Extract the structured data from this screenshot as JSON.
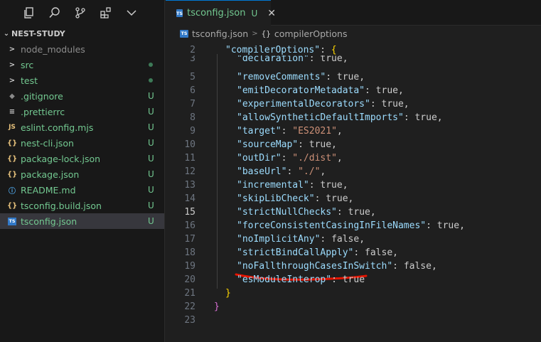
{
  "sidebar": {
    "project_name": "NEST-STUDY",
    "items": [
      {
        "name": "node_modules",
        "kind": "folder",
        "icon": ">",
        "color": "#8c8c8c",
        "badge": "",
        "dot": false
      },
      {
        "name": "src",
        "kind": "folder",
        "icon": ">",
        "color": "#73c991",
        "badge": "",
        "dot": true
      },
      {
        "name": "test",
        "kind": "folder",
        "icon": ">",
        "color": "#73c991",
        "badge": "",
        "dot": true
      },
      {
        "name": ".gitignore",
        "kind": "file",
        "icon": "◆",
        "iconColor": "#8a8a8a",
        "color": "#73c991",
        "badge": "U",
        "dot": false
      },
      {
        "name": ".prettierrc",
        "kind": "file",
        "icon": "≡",
        "iconColor": "#cccccc",
        "color": "#73c991",
        "badge": "U",
        "dot": false
      },
      {
        "name": "eslint.config.mjs",
        "kind": "file",
        "icon": "JS",
        "iconColor": "#e5c07b",
        "color": "#73c991",
        "badge": "U",
        "dot": false
      },
      {
        "name": "nest-cli.json",
        "kind": "file",
        "icon": "{}",
        "iconColor": "#e5c07b",
        "color": "#73c991",
        "badge": "U",
        "dot": false
      },
      {
        "name": "package-lock.json",
        "kind": "file",
        "icon": "{}",
        "iconColor": "#e5c07b",
        "color": "#73c991",
        "badge": "U",
        "dot": false
      },
      {
        "name": "package.json",
        "kind": "file",
        "icon": "{}",
        "iconColor": "#e5c07b",
        "color": "#73c991",
        "badge": "U",
        "dot": false
      },
      {
        "name": "README.md",
        "kind": "file",
        "icon": "ⓘ",
        "iconColor": "#4fa6e8",
        "color": "#73c991",
        "badge": "U",
        "dot": false
      },
      {
        "name": "tsconfig.build.json",
        "kind": "file",
        "icon": "{}",
        "iconColor": "#e5c07b",
        "color": "#73c991",
        "badge": "U",
        "dot": false
      },
      {
        "name": "tsconfig.json",
        "kind": "file",
        "icon": "TS",
        "iconColor": "#3178c6",
        "color": "#73c991",
        "badge": "U",
        "dot": false,
        "selected": true
      }
    ]
  },
  "tab": {
    "icon": "TS",
    "label": "tsconfig.json",
    "status": "U",
    "close": "✕"
  },
  "breadcrumb": {
    "file": "tsconfig.json",
    "separator": ">",
    "symbol_icon": "{}",
    "symbol": "compilerOptions"
  },
  "editor": {
    "active_line": "15",
    "lines": [
      {
        "n": "2",
        "tokens": [
          [
            "k",
            "\"compilerOptions\""
          ],
          [
            "p",
            ": "
          ],
          [
            "b2",
            "{"
          ]
        ],
        "indent": 1
      },
      {
        "n": "3",
        "tokens": [
          [
            "k",
            "\"declaration\""
          ],
          [
            "p",
            ": "
          ],
          [
            "v",
            "true,"
          ]
        ],
        "indent": 2
      },
      {
        "n": "5",
        "tokens": [
          [
            "k",
            "\"removeComments\""
          ],
          [
            "p",
            ": "
          ],
          [
            "v",
            "true,"
          ]
        ],
        "indent": 2
      },
      {
        "n": "6",
        "tokens": [
          [
            "k",
            "\"emitDecoratorMetadata\""
          ],
          [
            "p",
            ": "
          ],
          [
            "v",
            "true,"
          ]
        ],
        "indent": 2
      },
      {
        "n": "7",
        "tokens": [
          [
            "k",
            "\"experimentalDecorators\""
          ],
          [
            "p",
            ": "
          ],
          [
            "v",
            "true,"
          ]
        ],
        "indent": 2
      },
      {
        "n": "8",
        "tokens": [
          [
            "k",
            "\"allowSyntheticDefaultImports\""
          ],
          [
            "p",
            ": "
          ],
          [
            "v",
            "true,"
          ]
        ],
        "indent": 2
      },
      {
        "n": "9",
        "tokens": [
          [
            "k",
            "\"target\""
          ],
          [
            "p",
            ": "
          ],
          [
            "s",
            "\"ES2021\""
          ],
          [
            "p",
            ","
          ]
        ],
        "indent": 2
      },
      {
        "n": "10",
        "tokens": [
          [
            "k",
            "\"sourceMap\""
          ],
          [
            "p",
            ": "
          ],
          [
            "v",
            "true,"
          ]
        ],
        "indent": 2
      },
      {
        "n": "11",
        "tokens": [
          [
            "k",
            "\"outDir\""
          ],
          [
            "p",
            ": "
          ],
          [
            "s",
            "\"./dist\""
          ],
          [
            "p",
            ","
          ]
        ],
        "indent": 2
      },
      {
        "n": "12",
        "tokens": [
          [
            "k",
            "\"baseUrl\""
          ],
          [
            "p",
            ": "
          ],
          [
            "s",
            "\"./\""
          ],
          [
            "p",
            ","
          ]
        ],
        "indent": 2
      },
      {
        "n": "13",
        "tokens": [
          [
            "k",
            "\"incremental\""
          ],
          [
            "p",
            ": "
          ],
          [
            "v",
            "true,"
          ]
        ],
        "indent": 2
      },
      {
        "n": "14",
        "tokens": [
          [
            "k",
            "\"skipLibCheck\""
          ],
          [
            "p",
            ": "
          ],
          [
            "v",
            "true,"
          ]
        ],
        "indent": 2
      },
      {
        "n": "15",
        "tokens": [
          [
            "k",
            "\"strictNullChecks\""
          ],
          [
            "p",
            ": "
          ],
          [
            "v",
            "true,"
          ]
        ],
        "indent": 2
      },
      {
        "n": "16",
        "tokens": [
          [
            "k",
            "\"forceConsistentCasingInFileNames\""
          ],
          [
            "p",
            ": "
          ],
          [
            "v",
            "true,"
          ]
        ],
        "indent": 2
      },
      {
        "n": "17",
        "tokens": [
          [
            "k",
            "\"noImplicitAny\""
          ],
          [
            "p",
            ": "
          ],
          [
            "v",
            "false,"
          ]
        ],
        "indent": 2
      },
      {
        "n": "18",
        "tokens": [
          [
            "k",
            "\"strictBindCallApply\""
          ],
          [
            "p",
            ": "
          ],
          [
            "v",
            "false,"
          ]
        ],
        "indent": 2
      },
      {
        "n": "19",
        "tokens": [
          [
            "k",
            "\"noFallthroughCasesInSwitch\""
          ],
          [
            "p",
            ": "
          ],
          [
            "v",
            "false,"
          ]
        ],
        "indent": 2
      },
      {
        "n": "20",
        "tokens": [
          [
            "k",
            "\"esModuleInterop\""
          ],
          [
            "p",
            ": "
          ],
          [
            "v",
            "true"
          ]
        ],
        "indent": 2
      },
      {
        "n": "21",
        "tokens": [
          [
            "b2",
            "}"
          ]
        ],
        "indent": 1
      },
      {
        "n": "22",
        "tokens": [
          [
            "b",
            "}"
          ]
        ],
        "indent": 0
      },
      {
        "n": "23",
        "tokens": [],
        "indent": 0
      }
    ]
  },
  "colors": {
    "accent": "#0078d4",
    "git_untracked": "#73c991",
    "annotation": "#e51400"
  }
}
